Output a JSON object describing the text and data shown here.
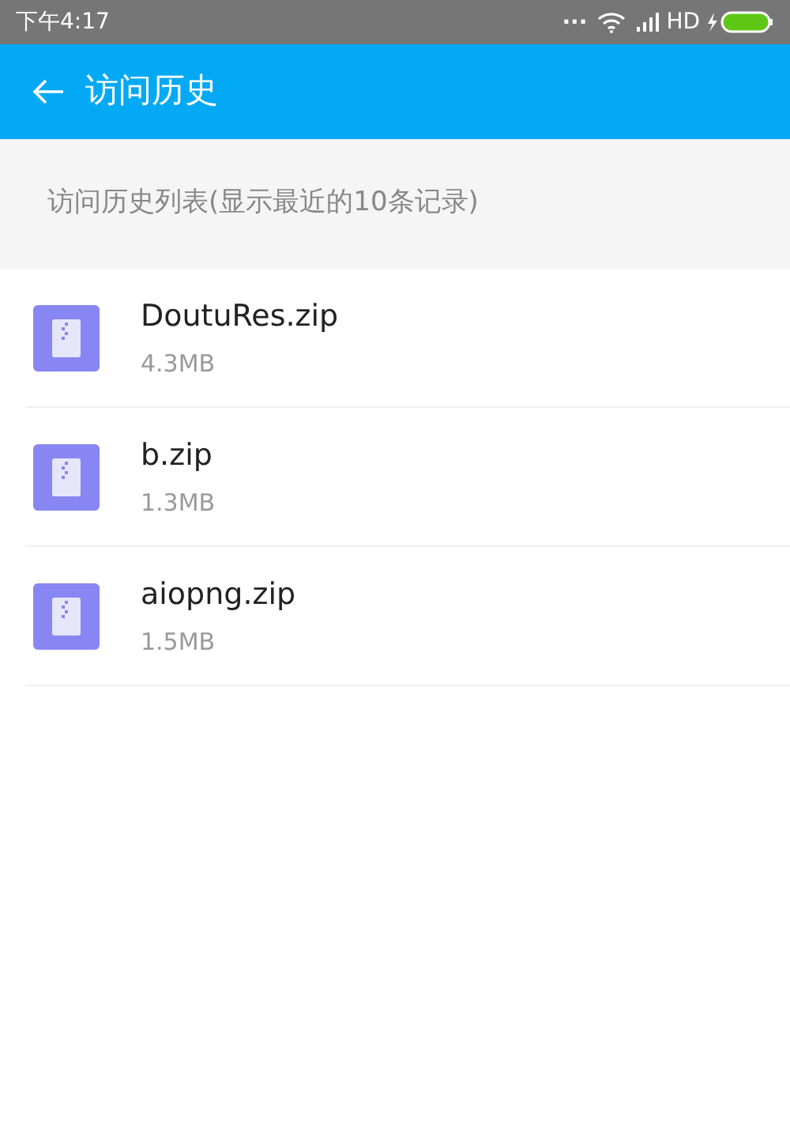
{
  "status_bar": {
    "time": "下午4:17",
    "dots": "...",
    "network": "HD"
  },
  "app_bar": {
    "title": "访问历史"
  },
  "section_header": "访问历史列表(显示最近的10条记录)",
  "files": [
    {
      "name": "DoutuRes.zip",
      "size": "4.3MB"
    },
    {
      "name": "b.zip",
      "size": "1.3MB"
    },
    {
      "name": "aiopng.zip",
      "size": "1.5MB"
    }
  ]
}
